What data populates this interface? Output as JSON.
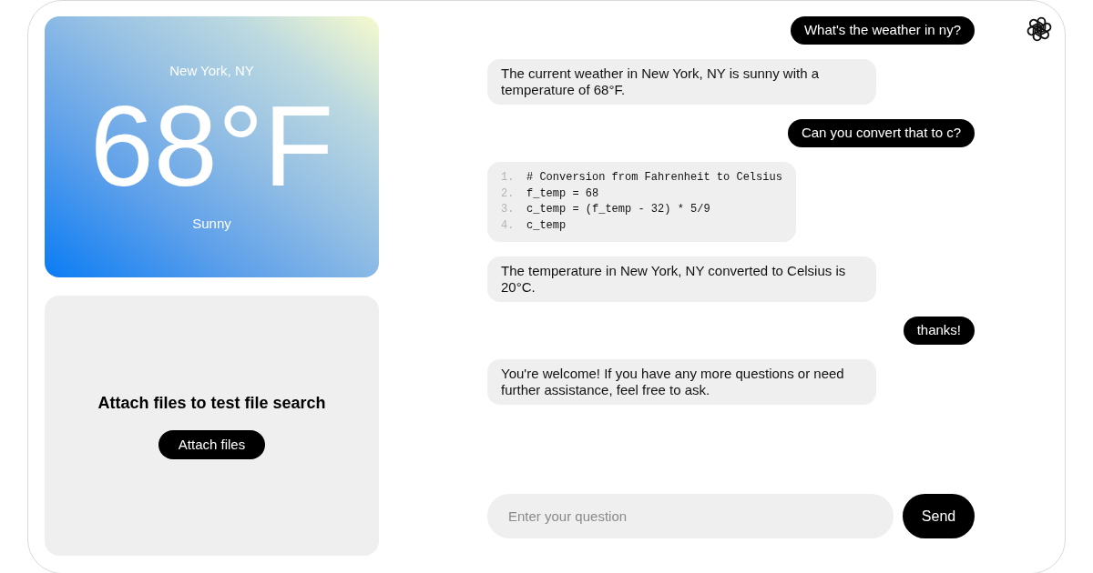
{
  "weather_card": {
    "location": "New York, NY",
    "temperature": "68°F",
    "condition": "Sunny"
  },
  "file_panel": {
    "title": "Attach files to test file search",
    "button": "Attach files"
  },
  "messages": [
    {
      "kind": "user",
      "text": "What's the weather in ny?"
    },
    {
      "kind": "assistant",
      "text": "The current weather in New York, NY is sunny with a temperature of 68°F."
    },
    {
      "kind": "user",
      "text": "Can you convert that to c?"
    },
    {
      "kind": "code",
      "lines": [
        {
          "number": "1.",
          "code": "# Conversion from Fahrenheit to Celsius"
        },
        {
          "number": "2.",
          "code": "f_temp = 68"
        },
        {
          "number": "3.",
          "code": "c_temp = (f_temp - 32) * 5/9"
        },
        {
          "number": "4.",
          "code": "c_temp"
        }
      ]
    },
    {
      "kind": "assistant",
      "text": "The temperature in New York, NY converted to Celsius is 20°C."
    },
    {
      "kind": "user",
      "text": "thanks!"
    },
    {
      "kind": "assistant",
      "text": "You're welcome! If you have any more questions or need further assistance, feel free to ask."
    }
  ],
  "composer": {
    "placeholder": "Enter your question",
    "button": "Send"
  }
}
